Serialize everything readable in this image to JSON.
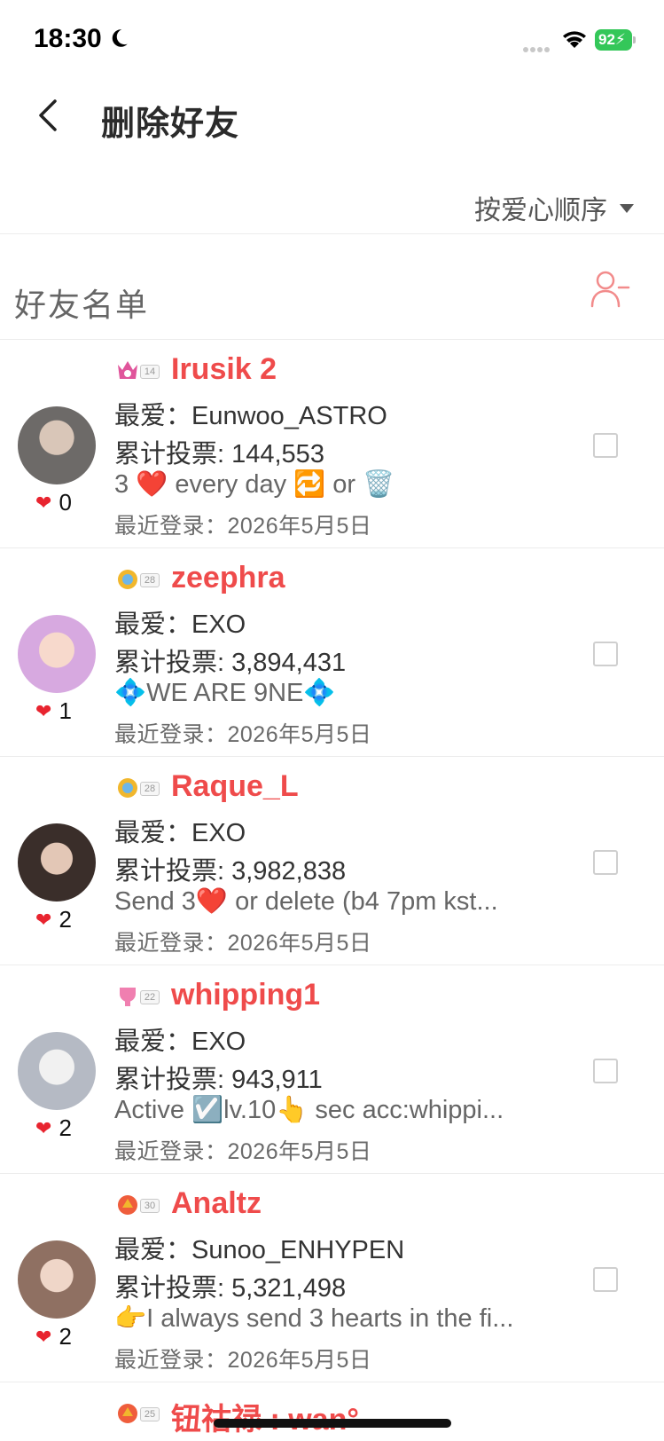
{
  "status_bar": {
    "time": "18:30",
    "battery": "92"
  },
  "header": {
    "title": "删除好友"
  },
  "sort": {
    "label": "按爱心顺序"
  },
  "section": {
    "title": "好友名单"
  },
  "friends": [
    {
      "level": "14",
      "username": "Irusik 2",
      "favorite": "最爱：Eunwoo_ASTRO",
      "votes": "累计投票: 144,553",
      "bio": "3 ❤️ every day 🔁 or 🗑️",
      "last_login": "最近登录：2026年5月5日",
      "hearts": "0",
      "crown_color": "#e0559b",
      "avatar_color": "#6d6a68"
    },
    {
      "level": "28",
      "username": "zeephra",
      "favorite": "最爱：EXO",
      "votes": "累计投票: 3,894,431",
      "bio": "💠WE ARE 9NE💠",
      "last_login": "最近登录：2026年5月5日",
      "hearts": "1",
      "crown_color": "#f1b72d",
      "avatar_color": "#d7a9e0"
    },
    {
      "level": "28",
      "username": "Raque_L",
      "favorite": "最爱：EXO",
      "votes": "累计投票: 3,982,838",
      "bio": "Send 3❤️ or delete (b4 7pm kst...",
      "last_login": "最近登录：2026年5月5日",
      "hearts": "2",
      "crown_color": "#f1b72d",
      "avatar_color": "#3a2e2a"
    },
    {
      "level": "22",
      "username": "whipping1",
      "favorite": "最爱：EXO",
      "votes": "累计投票: 943,911",
      "bio": "Active ☑️lv.10👆 sec acc:whippi...",
      "last_login": "最近登录：2026年5月5日",
      "hearts": "2",
      "crown_color": "#f07fb0",
      "avatar_color": "#b5bac4"
    },
    {
      "level": "30",
      "username": "Analtz",
      "favorite": "最爱：Sunoo_ENHYPEN",
      "votes": "累计投票: 5,321,498",
      "bio": "👉I always send 3 hearts in the fi...",
      "last_login": "最近登录：2026年5月5日",
      "hearts": "2",
      "crown_color": "#ef5d3c",
      "avatar_color": "#8f7062"
    }
  ],
  "partial_friend": {
    "level": "25",
    "username": "钮祜禄 : wan°",
    "crown_color": "#ef5d3c"
  }
}
